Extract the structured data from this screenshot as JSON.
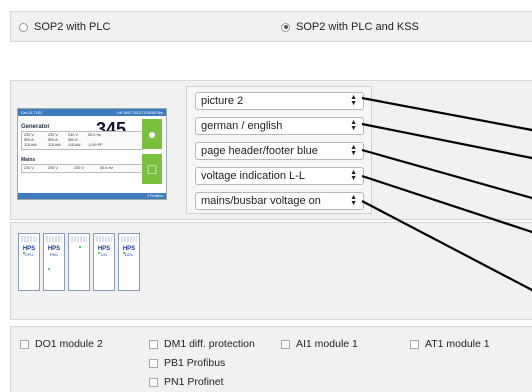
{
  "radio_options": [
    {
      "label": "SOP2 with PLC",
      "checked": false
    },
    {
      "label": "SOP2 with PLC and KSS",
      "checked": true
    }
  ],
  "device_screen": {
    "topbar_left": "Gen 21.7VDC",
    "topbar_right": "HH 16/07 2013  12:34:56 Gen",
    "generator_label": "Generator",
    "power_value": "345",
    "power_unit": "kW",
    "gen_rows": [
      [
        "230 V",
        "230 V",
        "230 V",
        "50.0 Hz"
      ],
      [
        "500 A",
        "500 A",
        "500 A",
        ""
      ],
      [
        "115 kW",
        "115 kW",
        "115 kW",
        "-0.99 PF"
      ]
    ],
    "mains_label": "Mains",
    "mains_row": [
      "230 V",
      "230 V",
      "230 V",
      "50.0 Hz"
    ],
    "footer_text": "3 Profibus"
  },
  "selects": [
    {
      "value": "picture 2"
    },
    {
      "value": "german / english"
    },
    {
      "value": "page header/footer blue"
    },
    {
      "value": "voltage indication L-L"
    },
    {
      "value": "mains/busbar voltage on"
    }
  ],
  "modules": [
    {
      "hps": "HPS",
      "label": "CPU"
    },
    {
      "hps": "HPS",
      "label": "PM1"
    },
    {
      "hps": "",
      "label": ""
    },
    {
      "hps": "HPS",
      "label": "DI1"
    },
    {
      "hps": "HPS",
      "label": "DO1"
    }
  ],
  "options": {
    "col1": [
      {
        "label": "DO1 module 2",
        "checked": false
      }
    ],
    "col2": [
      {
        "label": "DM1 diff. protection",
        "checked": false
      },
      {
        "label": "PB1 Profibus",
        "checked": false
      },
      {
        "label": "PN1 Profinet",
        "checked": false
      }
    ],
    "col3": [
      {
        "label": "AI1 module 1",
        "checked": false
      }
    ],
    "col4": [
      {
        "label": "AT1 module 1",
        "checked": false
      }
    ]
  }
}
